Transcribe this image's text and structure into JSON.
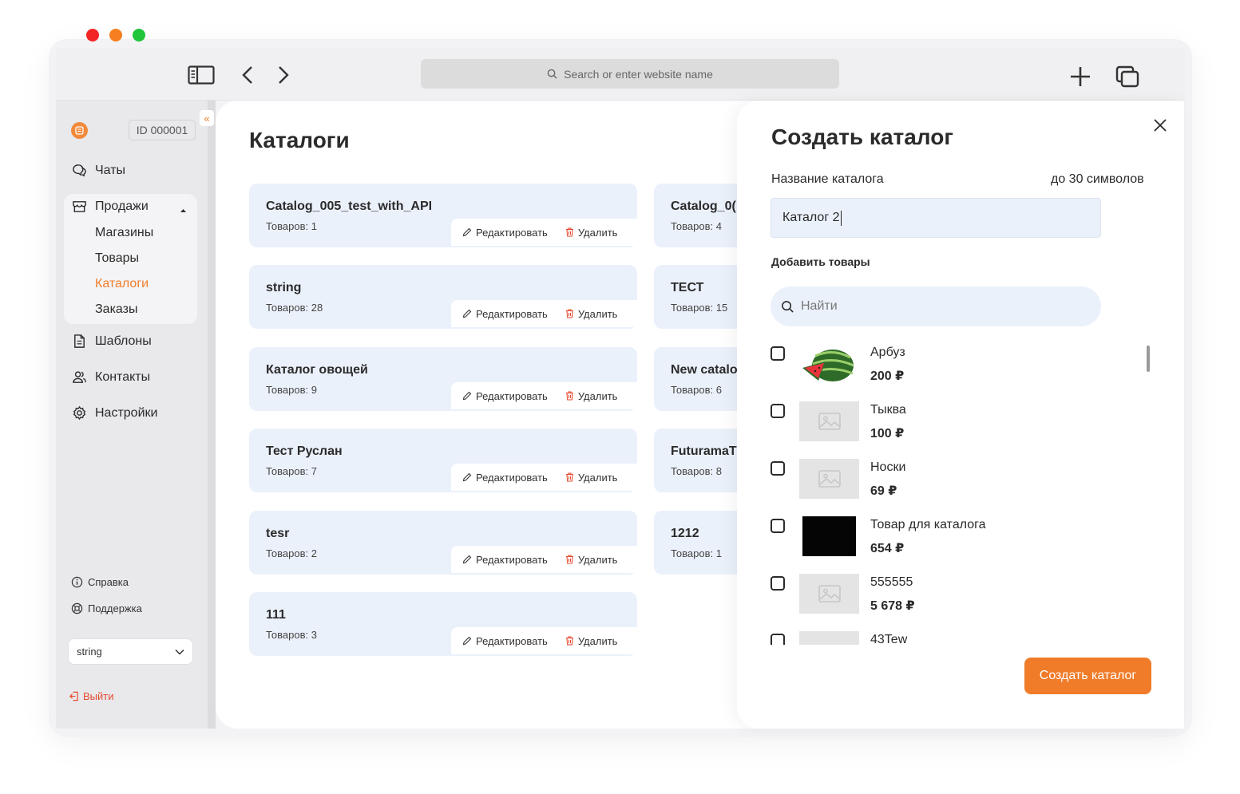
{
  "browser": {
    "url_placeholder": "Search or enter website name"
  },
  "sidebar": {
    "account_id": "ID 000001",
    "collapse_glyph": "«",
    "items": [
      {
        "label": "Чаты",
        "icon": "chat-icon"
      },
      {
        "label": "Продажи",
        "icon": "store-icon"
      },
      {
        "label": "Шаблоны",
        "icon": "document-icon"
      },
      {
        "label": "Контакты",
        "icon": "contacts-icon"
      },
      {
        "label": "Настройки",
        "icon": "gear-icon"
      }
    ],
    "sales_sub": [
      "Магазины",
      "Товары",
      "Каталоги",
      "Заказы"
    ],
    "active_sub": "Каталоги",
    "help": "Справка",
    "support": "Поддержка",
    "workspace_select": "string",
    "logout": "Выйти"
  },
  "main": {
    "title": "Каталоги",
    "edit_label": "Редактировать",
    "delete_label": "Удалить",
    "catalogs_col1": [
      {
        "name": "Catalog_005_test_with_API",
        "count": "Товаров: 1"
      },
      {
        "name": "string",
        "count": "Товаров: 28"
      },
      {
        "name": "Каталог овощей",
        "count": "Товаров: 9"
      },
      {
        "name": "Тест Руслан",
        "count": "Товаров: 7"
      },
      {
        "name": "tesr",
        "count": "Товаров: 2"
      },
      {
        "name": "111",
        "count": "Товаров: 3"
      }
    ],
    "catalogs_col2": [
      {
        "name": "Catalog_0(",
        "count": "Товаров: 4"
      },
      {
        "name": "ТЕСТ",
        "count": "Товаров: 15"
      },
      {
        "name": "New catalo",
        "count": "Товаров: 6"
      },
      {
        "name": "FuturamaT",
        "count": "Товаров: 8"
      },
      {
        "name": "1212",
        "count": "Товаров: 1"
      }
    ]
  },
  "modal": {
    "title": "Создать каталог",
    "name_label": "Название каталога",
    "name_limit": "до 30 символов",
    "name_value": "Каталог 2",
    "add_products_label": "Добавить товары",
    "search_placeholder": "Найти",
    "products": [
      {
        "name": "Арбуз",
        "price": "200 ₽",
        "image": "watermelon"
      },
      {
        "name": "Тыква",
        "price": "100 ₽",
        "image": "placeholder"
      },
      {
        "name": "Носки",
        "price": "69 ₽",
        "image": "placeholder"
      },
      {
        "name": "Товар для каталога",
        "price": "654 ₽",
        "image": "dark"
      },
      {
        "name": "555555",
        "price": "5 678 ₽",
        "image": "placeholder"
      },
      {
        "name": "43Tew",
        "price": "",
        "image": "placeholder"
      }
    ],
    "submit_label": "Создать каталог"
  },
  "colors": {
    "accent": "#f07c2a",
    "card_bg": "#ebf1fb",
    "danger": "#e6492d"
  }
}
